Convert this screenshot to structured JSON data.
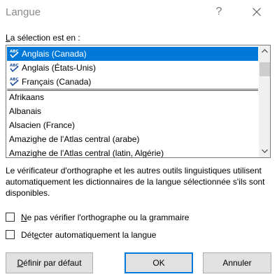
{
  "window": {
    "title": "Langue",
    "help_glyph": "?",
    "close_icon": "close-icon"
  },
  "selection_label_prefix": "L",
  "selection_label_rest": "a sélection est en :",
  "recent_languages": [
    {
      "label": "Anglais (Canada)",
      "selected": true,
      "icon": "spellcheck-abc-icon"
    },
    {
      "label": "Anglais (États-Unis)",
      "selected": false,
      "icon": "spellcheck-abc-icon"
    },
    {
      "label": "Français (Canada)",
      "selected": false,
      "icon": "spellcheck-abc-icon"
    }
  ],
  "all_languages": [
    "Afrikaans",
    "Albanais",
    "Alsacien (France)",
    "Amazighe de l'Atlas central (arabe)",
    "Amazighe de l'Atlas central (latin, Algérie)"
  ],
  "scroll_position": 0.0,
  "description": "Le vérificateur d'orthographe et les autres outils linguistiques utilisent automatiquement les dictionnaires de la langue sélectionnée s'ils sont disponibles.",
  "options": {
    "no_proofing": {
      "mnemonic": "N",
      "rest": "e pas vérifier l'orthographe ou la grammaire",
      "checked": false
    },
    "auto_detect": {
      "pre": "Dét",
      "mnemonic": "e",
      "rest": "cter automatiquement la langue",
      "checked": false
    }
  },
  "buttons": {
    "default": {
      "mnemonic": "D",
      "rest": "éfinir par défaut"
    },
    "ok": "OK",
    "cancel": "Annuler"
  },
  "colors": {
    "selection": "#0078d7",
    "title_text": "#8a8a8a"
  }
}
